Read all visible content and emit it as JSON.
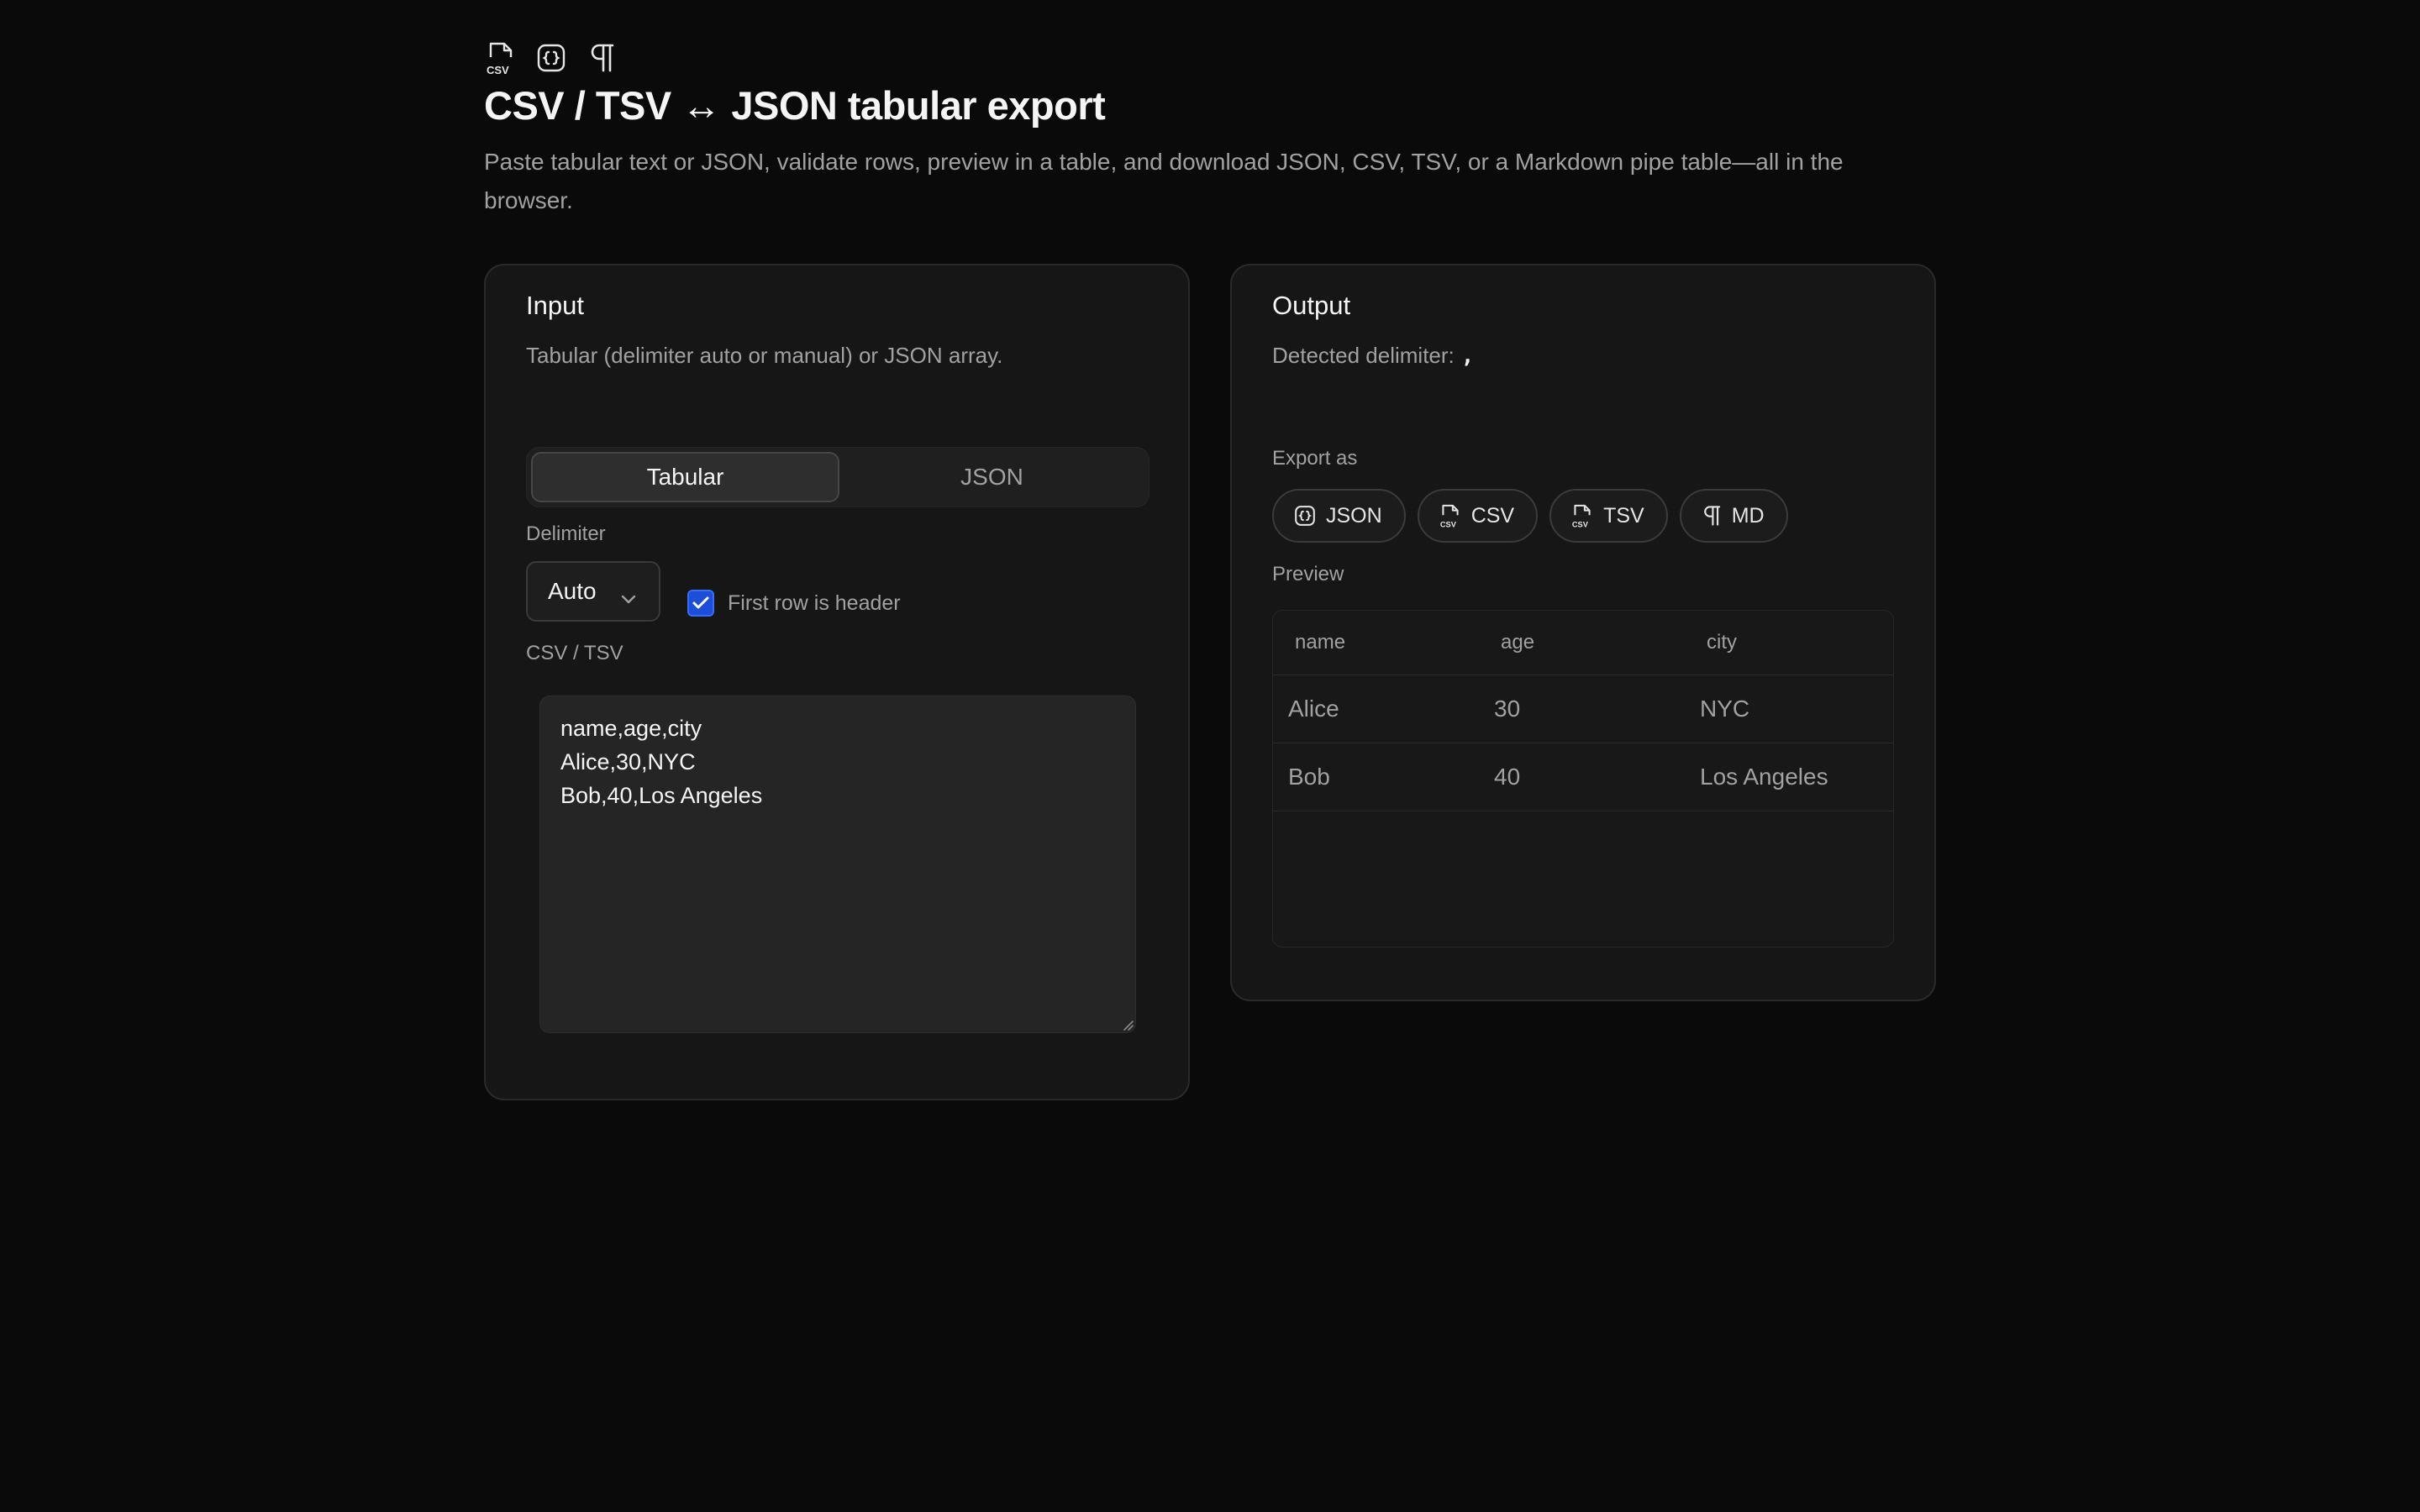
{
  "header": {
    "icons": [
      "csv-file-icon",
      "json-braces-icon",
      "pilcrow-icon"
    ],
    "title": "CSV / TSV ↔ JSON tabular export",
    "subtitle": "Paste tabular text or JSON, validate rows, preview in a table, and download JSON, CSV, TSV, or a Markdown pipe table—all in the browser."
  },
  "input": {
    "title": "Input",
    "description": "Tabular (delimiter auto or manual) or JSON array.",
    "tabs": [
      {
        "label": "Tabular",
        "active": true
      },
      {
        "label": "JSON",
        "active": false
      }
    ],
    "delimiter_label": "Delimiter",
    "delimiter_value": "Auto",
    "header_checkbox_label": "First row is header",
    "header_checked": true,
    "textarea_label": "CSV / TSV",
    "textarea_value": "name,age,city\nAlice,30,NYC\nBob,40,Los Angeles"
  },
  "output": {
    "title": "Output",
    "detected_label": "Detected delimiter:",
    "detected_value": ",",
    "export_label": "Export as",
    "export_buttons": [
      {
        "label": "JSON",
        "icon": "json-braces-icon"
      },
      {
        "label": "CSV",
        "icon": "csv-file-icon"
      },
      {
        "label": "TSV",
        "icon": "csv-file-icon"
      },
      {
        "label": "MD",
        "icon": "pilcrow-icon"
      }
    ],
    "preview_label": "Preview",
    "table": {
      "columns": [
        "name",
        "age",
        "city"
      ],
      "rows": [
        [
          "Alice",
          "30",
          "NYC"
        ],
        [
          "Bob",
          "40",
          "Los Angeles"
        ]
      ]
    }
  },
  "colors": {
    "background": "#0a0a0a",
    "card": "#161616",
    "accent": "#1d4ed8"
  }
}
